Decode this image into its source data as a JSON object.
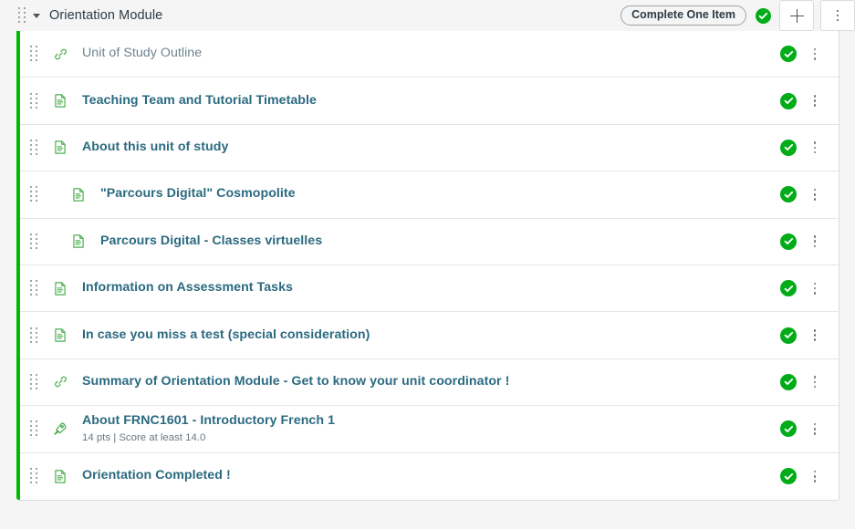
{
  "header": {
    "drag_handle": "drag-handle-icon",
    "collapse_icon": "caret-down-icon",
    "title": "Orientation Module",
    "requirement_pill": "Complete One Item",
    "published_icon": "check-circle-icon",
    "add_button": "plus-icon",
    "menu_button": "kebab-menu-icon"
  },
  "module_items": [
    {
      "title": "Unit of Study Outline",
      "icon": "link-icon",
      "indent": 0,
      "visited": true,
      "subtitle": "",
      "published": "check-circle-icon"
    },
    {
      "title": "Teaching Team and Tutorial Timetable",
      "icon": "page-icon",
      "indent": 0,
      "visited": false,
      "subtitle": "",
      "published": "check-circle-icon"
    },
    {
      "title": "About this unit of study",
      "icon": "page-icon",
      "indent": 0,
      "visited": false,
      "subtitle": "",
      "published": "check-circle-icon"
    },
    {
      "title": "\"Parcours Digital\" Cosmopolite",
      "icon": "page-icon",
      "indent": 1,
      "visited": false,
      "subtitle": "",
      "published": "check-circle-icon"
    },
    {
      "title": "Parcours Digital - Classes virtuelles",
      "icon": "page-icon",
      "indent": 1,
      "visited": false,
      "subtitle": "",
      "published": "check-circle-icon"
    },
    {
      "title": "Information on Assessment Tasks",
      "icon": "page-icon",
      "indent": 0,
      "visited": false,
      "subtitle": "",
      "published": "check-circle-icon"
    },
    {
      "title": "In case you miss a test (special consideration)",
      "icon": "page-icon",
      "indent": 0,
      "visited": false,
      "subtitle": "",
      "published": "check-circle-icon"
    },
    {
      "title": "Summary of Orientation Module - Get to know your unit coordinator !",
      "icon": "link-icon",
      "indent": 0,
      "visited": false,
      "subtitle": "",
      "published": "check-circle-icon"
    },
    {
      "title": "About FRNC1601 - Introductory French 1",
      "icon": "rocket-icon",
      "indent": 0,
      "visited": false,
      "subtitle": "14 pts  |  Score at least 14.0",
      "published": "check-circle-icon"
    },
    {
      "title": "Orientation Completed !",
      "icon": "page-icon",
      "indent": 0,
      "visited": false,
      "subtitle": "",
      "published": "check-circle-icon"
    }
  ],
  "colors": {
    "published_green": "#00ac18",
    "rail_green": "#00ba00",
    "icon_green": "#4caf50",
    "link_text": "#2b6a80",
    "visited_text": "#6d8391",
    "header_bg": "#f5f5f5"
  }
}
